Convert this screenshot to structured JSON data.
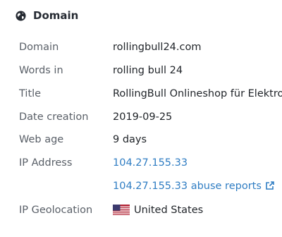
{
  "section": {
    "title": "Domain",
    "icon": "globe-icon"
  },
  "rows": [
    {
      "label": "Domain",
      "value": "rollingbull24.com"
    },
    {
      "label": "Words in",
      "value": "rolling bull 24"
    },
    {
      "label": "Title",
      "value": "RollingBull Onlineshop für Elektro"
    },
    {
      "label": "Date creation",
      "value": "2019-09-25"
    },
    {
      "label": "Web age",
      "value": "9 days"
    },
    {
      "label": "IP Address",
      "value": "104.27.155.33"
    }
  ],
  "abuse_link": {
    "text": "104.27.155.33 abuse reports",
    "icon": "external-link-icon"
  },
  "geo": {
    "label": "IP Geolocation",
    "value": "United States",
    "icon": "us-flag-icon"
  },
  "colors": {
    "link": "#2f7dc3",
    "label": "#5a6068",
    "text": "#1f2328"
  }
}
